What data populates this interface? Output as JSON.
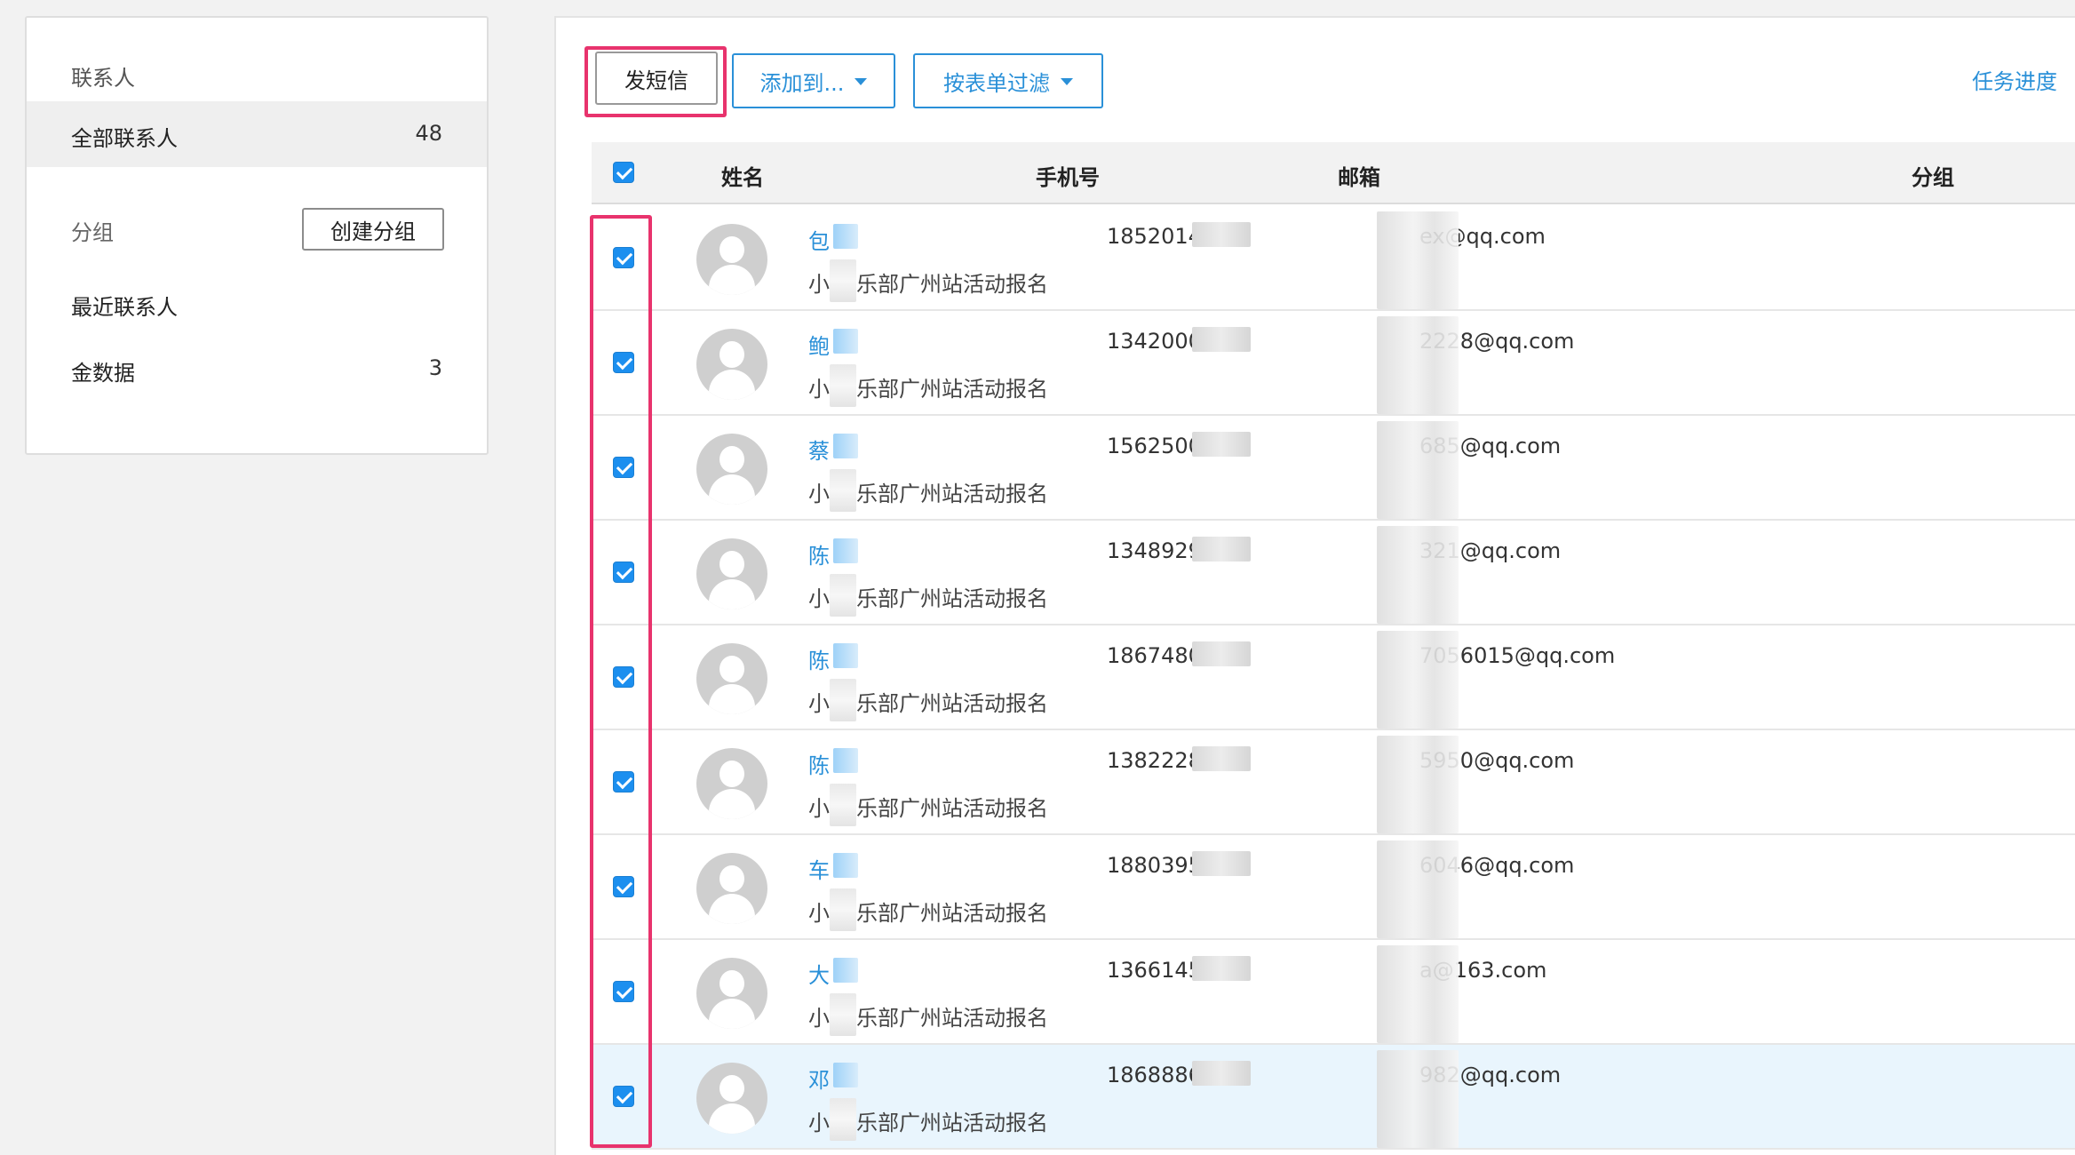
{
  "sidebar": {
    "title": "联系人",
    "all_contacts": {
      "label": "全部联系人",
      "count": "48"
    },
    "group_label": "分组",
    "create_group_button": "创建分组",
    "recent_contacts": "最近联系人",
    "jin_data": {
      "label": "金数据",
      "count": "3"
    }
  },
  "toolbar": {
    "send_sms": "发短信",
    "add_to": "添加到...",
    "filter_by_form": "按表单过滤",
    "task_progress": "任务进度"
  },
  "table": {
    "headers": {
      "name": "姓名",
      "phone": "手机号",
      "email": "邮箱",
      "group": "分组"
    },
    "rows": [
      {
        "name": "包",
        "subtitle": "小",
        "subtitle_rest": "乐部广州站活动报名",
        "phone": "1852014",
        "email": "ex@qq.com",
        "selected": false
      },
      {
        "name": "鲍",
        "subtitle": "小",
        "subtitle_rest": "乐部广州站活动报名",
        "phone": "1342000",
        "email": "2228@qq.com",
        "selected": false
      },
      {
        "name": "蔡",
        "subtitle": "小",
        "subtitle_rest": "乐部广州站活动报名",
        "phone": "1562500",
        "email": "685@qq.com",
        "selected": false
      },
      {
        "name": "陈",
        "subtitle": "小",
        "subtitle_rest": "乐部广州站活动报名",
        "phone": "1348929",
        "email": "321@qq.com",
        "selected": false
      },
      {
        "name": "陈",
        "subtitle": "小",
        "subtitle_rest": "乐部广州站活动报名",
        "phone": "1867480",
        "email": "7056015@qq.com",
        "selected": false
      },
      {
        "name": "陈",
        "subtitle": "小",
        "subtitle_rest": "乐部广州站活动报名",
        "phone": "1382228",
        "email": "5950@qq.com",
        "selected": false
      },
      {
        "name": "车",
        "subtitle": "小",
        "subtitle_rest": "乐部广州站活动报名",
        "phone": "1880395",
        "email": "6046@qq.com",
        "selected": false
      },
      {
        "name": "大",
        "subtitle": "小",
        "subtitle_rest": "乐部广州站活动报名",
        "phone": "1366145",
        "email": "a@163.com",
        "selected": false
      },
      {
        "name": "邓",
        "subtitle": "小",
        "subtitle_rest": "乐部广州站活动报名",
        "phone": "1868886",
        "email": "982@qq.com",
        "selected": true
      }
    ]
  },
  "colors": {
    "accent": "#2a90d8",
    "highlight": "#e8336d",
    "checkbox": "#1c8fef",
    "selected_row": "#e9f5fd"
  }
}
